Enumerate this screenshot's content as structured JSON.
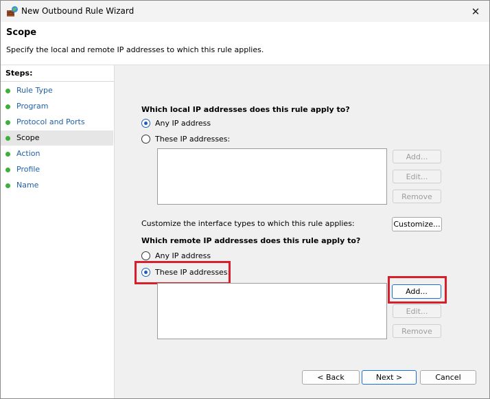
{
  "window": {
    "title": "New Outbound Rule Wizard"
  },
  "header": {
    "title": "Scope",
    "description": "Specify the local and remote IP addresses to which this rule applies."
  },
  "steps": {
    "title": "Steps:",
    "items": [
      {
        "label": "Rule Type"
      },
      {
        "label": "Program"
      },
      {
        "label": "Protocol and Ports"
      },
      {
        "label": "Scope"
      },
      {
        "label": "Action"
      },
      {
        "label": "Profile"
      },
      {
        "label": "Name"
      }
    ],
    "active_index": 3
  },
  "local": {
    "question": "Which local IP addresses does this rule apply to?",
    "any_label": "Any IP address",
    "these_label": "These IP addresses:",
    "selected": "any",
    "add_label": "Add...",
    "edit_label": "Edit...",
    "remove_label": "Remove"
  },
  "interface": {
    "text": "Customize the interface types to which this rule applies:",
    "customize_label": "Customize..."
  },
  "remote": {
    "question": "Which remote IP addresses does this rule apply to?",
    "any_label": "Any IP address",
    "these_label": "These IP addresses:",
    "selected": "these",
    "add_label": "Add...",
    "edit_label": "Edit...",
    "remove_label": "Remove"
  },
  "footer": {
    "back_label": "< Back",
    "next_label": "Next >",
    "cancel_label": "Cancel"
  },
  "colors": {
    "highlight": "#d81e2b",
    "step_dot": "#3bb13b",
    "link": "#1f5faa",
    "radio_selected": "#1d5fb4"
  }
}
